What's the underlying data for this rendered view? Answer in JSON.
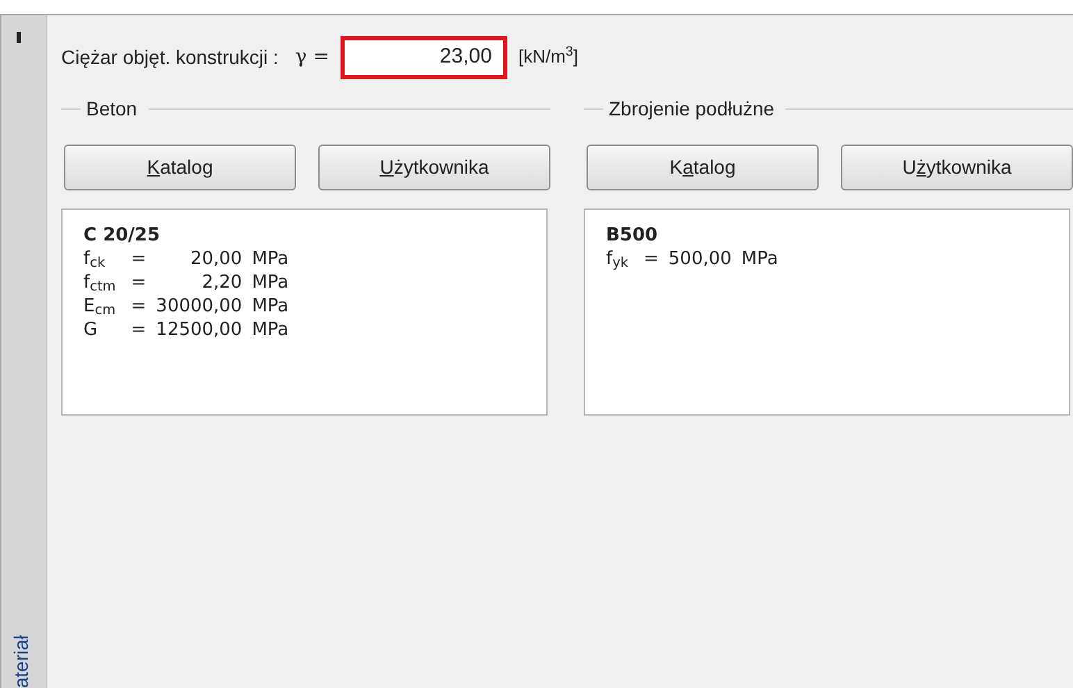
{
  "side_tabs": [
    {
      "label": "ateriał",
      "selected": true
    }
  ],
  "unit_weight": {
    "label": "Ciężar objęt. konstrukcji :",
    "symbol": "γ =",
    "value": "23,00",
    "unit": "[kN/m$^{3}$]",
    "highlighted": true
  },
  "groups": [
    {
      "title": "Beton",
      "buttons": [
        {
          "label": "Katalog",
          "kind": "firstkey"
        },
        {
          "label": "Użytkownika",
          "kind": "firstkey"
        }
      ],
      "material": {
        "name": "C 20/25",
        "rows": [
          {
            "symbol": "f$_{ck}$",
            "eq": "=",
            "value": "20,00",
            "unit": "MPa"
          },
          {
            "symbol": "f$_{ctm}$",
            "eq": "=",
            "value": "2,20",
            "unit": "MPa"
          },
          {
            "symbol": "E$_{cm}$",
            "eq": "=",
            "value": "30000,00",
            "unit": "MPa"
          },
          {
            "symbol": "G",
            "eq": "=",
            "value": "12500,00",
            "unit": "MPa"
          }
        ]
      }
    },
    {
      "title": "Zbrojenie podłużne",
      "buttons": [
        {
          "label": "Katalog",
          "kind": "secondkey"
        },
        {
          "label": "Użytkownika",
          "kind": "secondkey"
        }
      ],
      "material": {
        "name": "B500",
        "rows": [
          {
            "symbol": "f$_{yk}$",
            "eq": "=",
            "value": "500,00",
            "unit": "MPa"
          }
        ]
      }
    }
  ]
}
